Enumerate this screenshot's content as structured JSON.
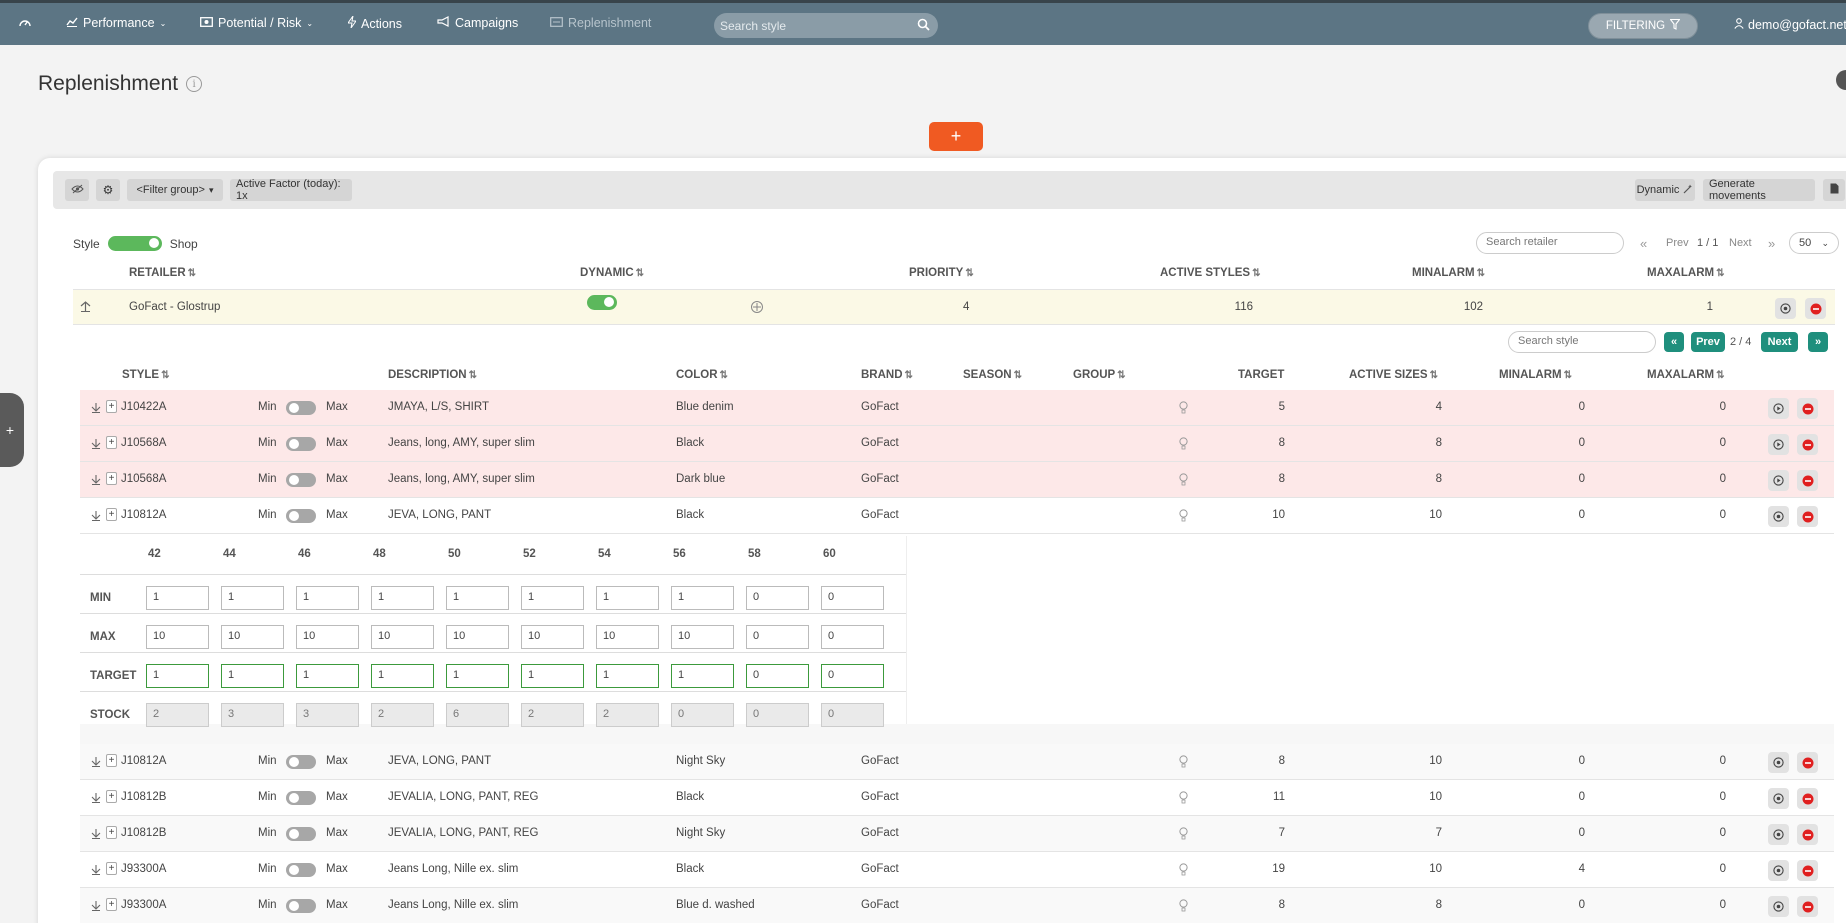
{
  "nav": {
    "items": [
      {
        "label": "Performance",
        "icon": "chart-icon"
      },
      {
        "label": "Potential / Risk",
        "icon": "money-icon"
      },
      {
        "label": "Actions",
        "icon": "bolt-icon"
      },
      {
        "label": "Campaigns",
        "icon": "megaphone-icon"
      },
      {
        "label": "Replenishment",
        "icon": "replenish-icon"
      }
    ],
    "search_placeholder": "Search style",
    "filtering_label": "FILTERING",
    "user": "demo@gofact.net"
  },
  "page": {
    "title": "Replenishment",
    "add_label": "+"
  },
  "toolbar": {
    "filter_group": "<Filter group>",
    "active_factor": "Active Factor (today):  1x",
    "dynamic_label": "Dynamic",
    "generate_label": "Generate movements"
  },
  "view_toggle": {
    "left": "Style",
    "right": "Shop"
  },
  "retailer_pager": {
    "search_placeholder": "Search retailer",
    "first": "«",
    "prev": "Prev",
    "page": "1 / 1",
    "next": "Next",
    "last": "»",
    "page_size": "50"
  },
  "retailer_headers": {
    "retailer": "RETAILER",
    "dynamic": "DYNAMIC",
    "priority": "PRIORITY",
    "active_styles": "ACTIVE STYLES",
    "minalarm": "MINALARM",
    "maxalarm": "MAXALARM"
  },
  "retailer_row": {
    "name": "GoFact - Glostrup",
    "priority": "4",
    "active_styles": "116",
    "minalarm": "102",
    "maxalarm": "1"
  },
  "style_pager": {
    "search_placeholder": "Search style",
    "first": "«",
    "prev": "Prev",
    "page": "2 / 4",
    "next": "Next",
    "last": "»"
  },
  "style_headers": {
    "style": "STYLE",
    "description": "DESCRIPTION",
    "color": "COLOR",
    "brand": "BRAND",
    "season": "SEASON",
    "group": "GROUP",
    "target": "TARGET",
    "active_sizes": "ACTIVE SIZES",
    "minalarm": "MINALARM",
    "maxalarm": "MAXALARM"
  },
  "minmax": {
    "min": "Min",
    "max": "Max"
  },
  "styles_top": [
    {
      "style": "J10422A",
      "description": "JMAYA, L/S, SHIRT",
      "color": "Blue denim",
      "brand": "GoFact",
      "target": "5",
      "active_sizes": "4",
      "minalarm": "0",
      "maxalarm": "0",
      "status": "alarm"
    },
    {
      "style": "J10568A",
      "description": "Jeans, long, AMY, super slim",
      "color": "Black",
      "brand": "GoFact",
      "target": "8",
      "active_sizes": "8",
      "minalarm": "0",
      "maxalarm": "0",
      "status": "alarm"
    },
    {
      "style": "J10568A",
      "description": "Jeans, long, AMY, super slim",
      "color": "Dark blue",
      "brand": "GoFact",
      "target": "8",
      "active_sizes": "8",
      "minalarm": "0",
      "maxalarm": "0",
      "status": "alarm"
    },
    {
      "style": "J10812A",
      "description": "JEVA, LONG, PANT",
      "color": "Black",
      "brand": "GoFact",
      "target": "10",
      "active_sizes": "10",
      "minalarm": "0",
      "maxalarm": "0",
      "status": "expanded"
    }
  ],
  "size_grid": {
    "sizes": [
      "42",
      "44",
      "46",
      "48",
      "50",
      "52",
      "54",
      "56",
      "58",
      "60"
    ],
    "rows": [
      {
        "label": "MIN",
        "values": [
          "1",
          "1",
          "1",
          "1",
          "1",
          "1",
          "1",
          "1",
          "0",
          "0"
        ]
      },
      {
        "label": "MAX",
        "values": [
          "10",
          "10",
          "10",
          "10",
          "10",
          "10",
          "10",
          "10",
          "0",
          "0"
        ]
      },
      {
        "label": "TARGET",
        "values": [
          "1",
          "1",
          "1",
          "1",
          "1",
          "1",
          "1",
          "1",
          "0",
          "0"
        ]
      },
      {
        "label": "STOCK",
        "values": [
          "2",
          "3",
          "3",
          "2",
          "6",
          "2",
          "2",
          "0",
          "0",
          "0"
        ]
      }
    ]
  },
  "styles_bottom": [
    {
      "style": "J10812A",
      "description": "JEVA, LONG, PANT",
      "color": "Night Sky",
      "brand": "GoFact",
      "target": "8",
      "active_sizes": "10",
      "minalarm": "0",
      "maxalarm": "0"
    },
    {
      "style": "J10812B",
      "description": "JEVALIA, LONG, PANT, REG",
      "color": "Black",
      "brand": "GoFact",
      "target": "11",
      "active_sizes": "10",
      "minalarm": "0",
      "maxalarm": "0"
    },
    {
      "style": "J10812B",
      "description": "JEVALIA, LONG, PANT, REG",
      "color": "Night Sky",
      "brand": "GoFact",
      "target": "7",
      "active_sizes": "7",
      "minalarm": "0",
      "maxalarm": "0"
    },
    {
      "style": "J93300A",
      "description": "Jeans Long, Nille ex. slim",
      "color": "Black",
      "brand": "GoFact",
      "target": "19",
      "active_sizes": "10",
      "minalarm": "4",
      "maxalarm": "0"
    },
    {
      "style": "J93300A",
      "description": "Jeans Long, Nille ex. slim",
      "color": "Blue d. washed",
      "brand": "GoFact",
      "target": "8",
      "active_sizes": "8",
      "minalarm": "0",
      "maxalarm": "0"
    }
  ],
  "colors": {
    "topbar": "#5c7584",
    "accent": "#f05a22",
    "toggle_on": "#5cb85c",
    "pager": "#1f8f7d",
    "alarm_row": "#fde8e8"
  }
}
